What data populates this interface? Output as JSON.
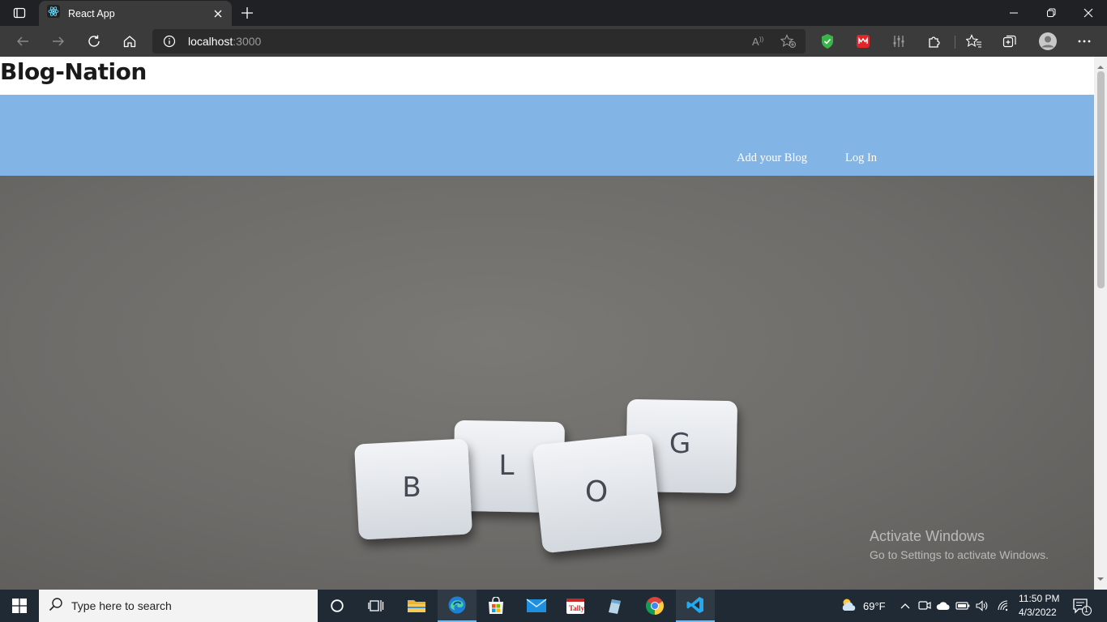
{
  "browser": {
    "tab_title": "React App",
    "address": {
      "host": "localhost",
      "port": ":3000"
    }
  },
  "page": {
    "site_title": "Blog-Nation",
    "nav": [
      {
        "label": "Add your Blog"
      },
      {
        "label": "Log In"
      }
    ],
    "hero_tiles": [
      "B",
      "L",
      "O",
      "G"
    ]
  },
  "watermark": {
    "line1": "Activate Windows",
    "line2": "Go to Settings to activate Windows."
  },
  "taskbar": {
    "search_placeholder": "Type here to search",
    "weather": "69°F",
    "time": "11:50 PM",
    "date": "4/3/2022",
    "notifications": "1"
  },
  "colors": {
    "navbar": "#83b4e6",
    "tab_active": "#3b3b3b",
    "toolbar": "#3b3b3b",
    "taskbar": "#1f2a35"
  }
}
